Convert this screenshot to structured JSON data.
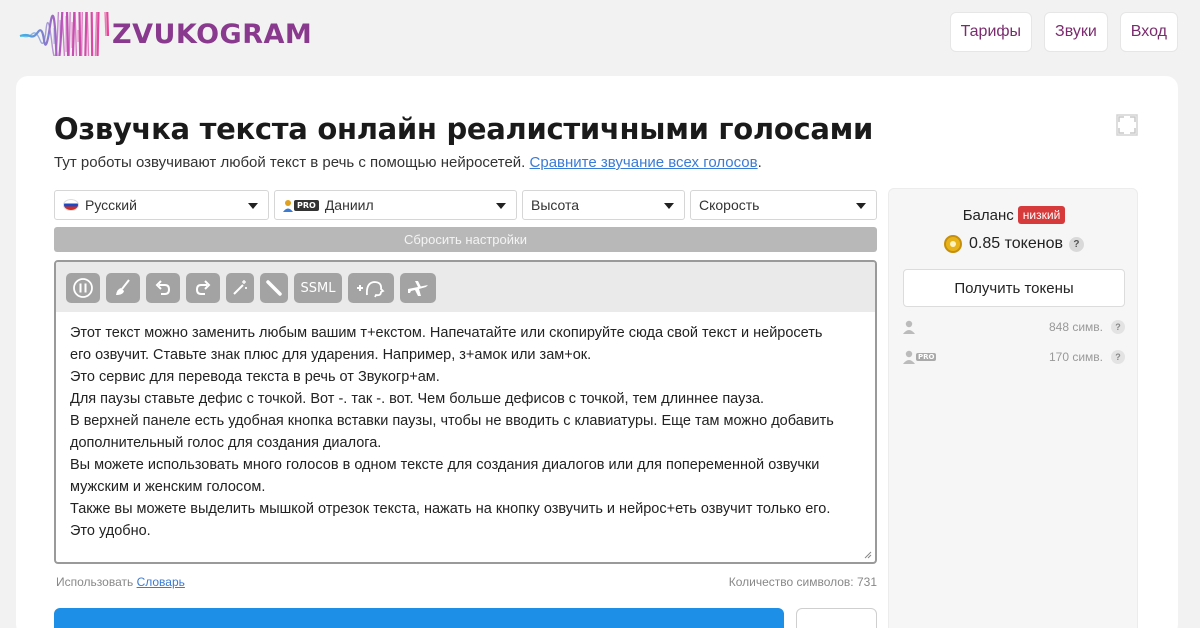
{
  "header": {
    "logo_text": "ZVUKOGRAM",
    "nav": [
      {
        "label": "Тарифы"
      },
      {
        "label": "Звуки"
      },
      {
        "label": "Вход"
      }
    ]
  },
  "main": {
    "title": "Озвучка текста онлайн реалистичными голосами",
    "subtitle": "Тут роботы озвучивают любой текст в речь с помощью нейросетей.",
    "subtitle_link": "Сравните звучание всех голосов",
    "subtitle_end": ".",
    "selects": {
      "language": "Русский",
      "voice_badge": "PRO",
      "voice": "Даниил",
      "pitch": "Высота",
      "speed": "Скорость"
    },
    "reset_label": "Сбросить настройки",
    "toolbar": {
      "ssml_label": "SSML",
      "icons": [
        "pause-icon",
        "broom-icon",
        "undo-icon",
        "redo-icon",
        "magic-icon",
        "pencil-icon",
        "ssml",
        "add-voice-icon",
        "airplane-icon"
      ]
    },
    "editor_lines": [
      "Этот текст можно заменить любым вашим т+екстом. Напечатайте или скопируйте сюда свой текст и нейросеть",
      "его озвучит. Ставьте знак плюс для ударения. Например, з+амок или зам+ок.",
      "Это сервис для перевода текста в речь от Звукогр+ам.",
      "Для паузы ставьте дефис с точкой. Вот -. так -. вот. Чем больше дефисов с точкой, тем длиннее пауза.",
      "В верхней панеле есть удобная кнопка вставки паузы, чтобы не вводить с клавиатуры. Еще там можно добавить",
      "дополнительный голос для создания диалога.",
      "Вы можете использовать много голосов в одном тексте для создания диалогов или для попеременной озвучки",
      "мужским и женским голосом.",
      "Также вы можете выделить мышкой отрезок текста, нажать на кнопку озвучить и нейрос+еть озвучит только его.",
      "Это удобно."
    ],
    "footer": {
      "use_label": "Использовать",
      "dictionary_link": "Словарь",
      "char_count_label": "Количество символов: 731"
    }
  },
  "side": {
    "balance_label": "Баланс",
    "balance_status": "низкий",
    "tokens": "0.85 токенов",
    "help": "?",
    "get_tokens_label": "Получить токены",
    "rows": [
      {
        "badge": "",
        "value": "848 симв."
      },
      {
        "badge": "PRO",
        "value": "170 симв."
      }
    ]
  },
  "colors": {
    "brand": "#8a3a8e",
    "link": "#3a7bd5",
    "primary": "#1d8fe6",
    "low_badge": "#d63a3a"
  }
}
